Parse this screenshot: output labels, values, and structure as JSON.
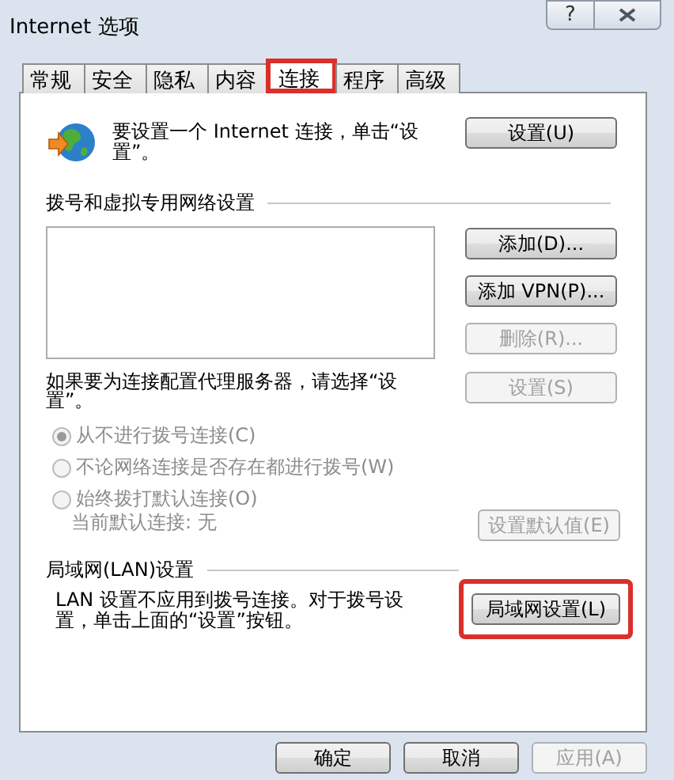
{
  "window": {
    "title": "Internet 选项",
    "help": "?"
  },
  "tabs": [
    {
      "label": "常规",
      "selected": false,
      "highlighted": false
    },
    {
      "label": "安全",
      "selected": false,
      "highlighted": false
    },
    {
      "label": "隐私",
      "selected": false,
      "highlighted": false
    },
    {
      "label": "内容",
      "selected": false,
      "highlighted": false
    },
    {
      "label": "连接",
      "selected": true,
      "highlighted": true
    },
    {
      "label": "程序",
      "selected": false,
      "highlighted": false
    },
    {
      "label": "高级",
      "selected": false,
      "highlighted": false
    }
  ],
  "setup": {
    "text": "要设置一个 Internet 连接，单击“设置”。",
    "button": {
      "label": "设置(U)",
      "disabled": false
    }
  },
  "dialup": {
    "heading": "拨号和虚拟专用网络设置",
    "buttons": [
      {
        "label": "添加(D)...",
        "disabled": false
      },
      {
        "label": "添加 VPN(P)...",
        "disabled": false
      },
      {
        "label": "删除(R)...",
        "disabled": true
      }
    ],
    "proxy_text": "如果要为连接配置代理服务器，请选择“设置”。",
    "proxy_button": {
      "label": "设置(S)",
      "disabled": true
    },
    "options": [
      {
        "label": "从不进行拨号连接(C)",
        "selected": true,
        "disabled": true
      },
      {
        "label": "不论网络连接是否存在都进行拨号(W)",
        "selected": false,
        "disabled": true
      },
      {
        "label": "始终拨打默认连接(O)",
        "selected": false,
        "disabled": true
      }
    ],
    "current_label": "当前默认连接:",
    "current_value": "无",
    "default_button": {
      "label": "设置默认值(E)",
      "disabled": true
    }
  },
  "lan": {
    "heading": "局域网(LAN)设置",
    "text": "LAN 设置不应用到拨号连接。对于拨号设置，单击上面的“设置”按钮。",
    "button": {
      "label": "局域网设置(L)",
      "disabled": false,
      "highlighted": true
    }
  },
  "footer": [
    {
      "label": "确定",
      "disabled": false
    },
    {
      "label": "取消",
      "disabled": false
    },
    {
      "label": "应用(A)",
      "disabled": true
    }
  ]
}
